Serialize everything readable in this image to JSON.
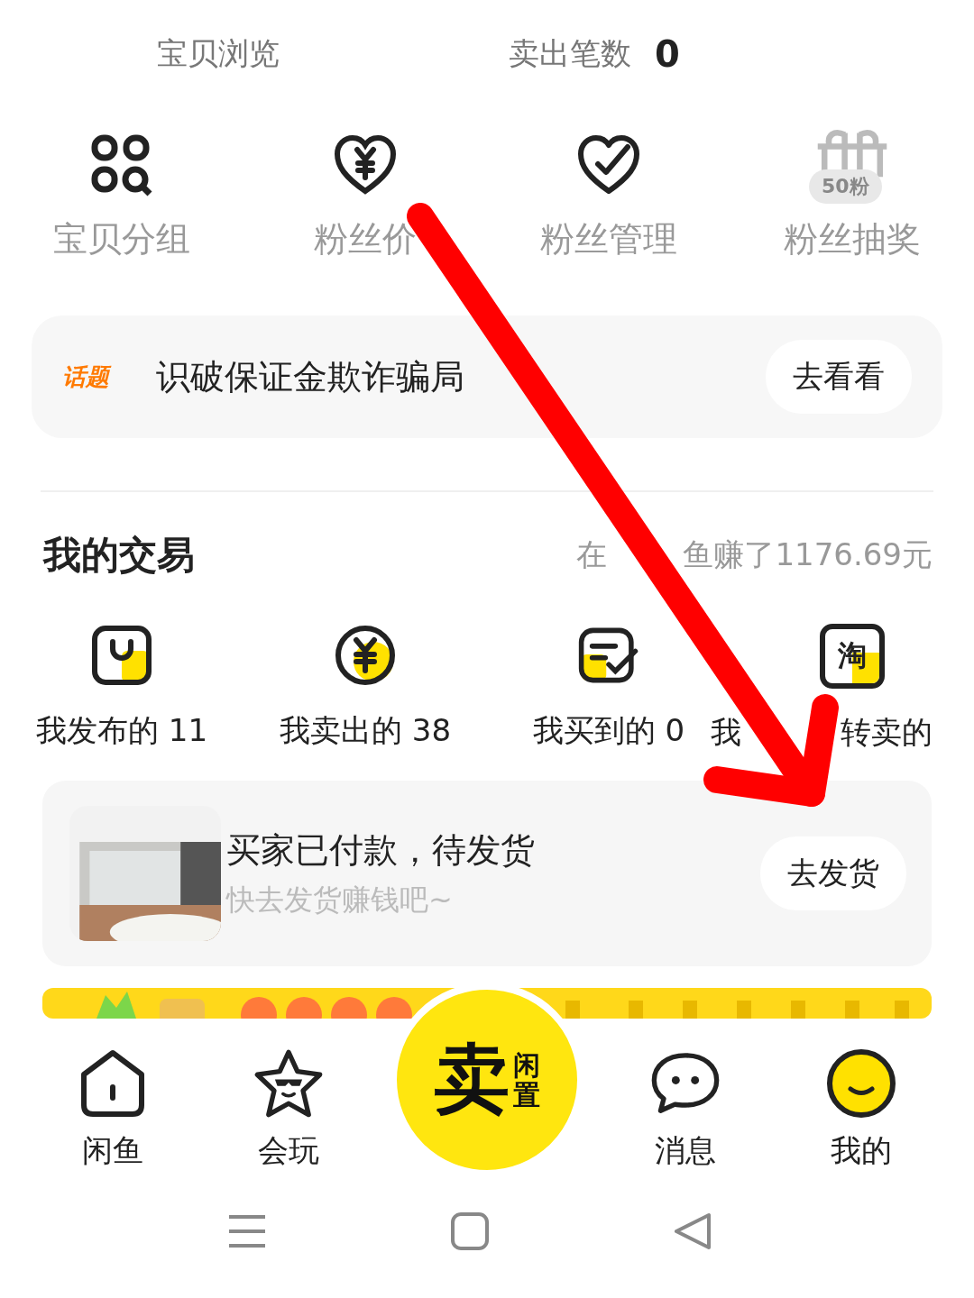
{
  "stats": [
    {
      "label": "宝贝浏览"
    },
    {
      "label": "卖出笔数",
      "value": "0"
    }
  ],
  "tools": [
    {
      "kind": "group",
      "label": "宝贝分组"
    },
    {
      "kind": "fan_price",
      "label": "粉丝价"
    },
    {
      "kind": "fan_manage",
      "label": "粉丝管理"
    },
    {
      "kind": "lottery",
      "label": "粉丝抽奖",
      "badge": "50粉"
    }
  ],
  "topic": {
    "tag": "话题",
    "title": "识破保证金欺诈骗局",
    "button": "去看看"
  },
  "trade": {
    "title": "我的交易",
    "earnings": [
      "在",
      "鱼赚了1176.69元"
    ],
    "items": [
      {
        "kind": "published",
        "label_parts": [
          "我发布的 11"
        ]
      },
      {
        "kind": "sold",
        "label_parts": [
          "我卖出的 38"
        ]
      },
      {
        "kind": "bought",
        "label_parts": [
          "我买到的 0"
        ]
      },
      {
        "kind": "taobao",
        "icon_text": "淘",
        "label_parts": [
          "我",
          "转卖的"
        ]
      }
    ]
  },
  "order": {
    "title": "买家已付款，待发货",
    "subtitle": "快去发货赚钱吧~",
    "button": "去发货"
  },
  "tabs": [
    {
      "kind": "home",
      "label": "闲鱼",
      "selected": false
    },
    {
      "kind": "play",
      "label": "会玩",
      "selected": false
    },
    {
      "kind": "sell",
      "label": "卖",
      "sublabel": "闲置"
    },
    {
      "kind": "message",
      "label": "消息",
      "selected": false
    },
    {
      "kind": "me",
      "label": "我的",
      "selected": true
    }
  ]
}
